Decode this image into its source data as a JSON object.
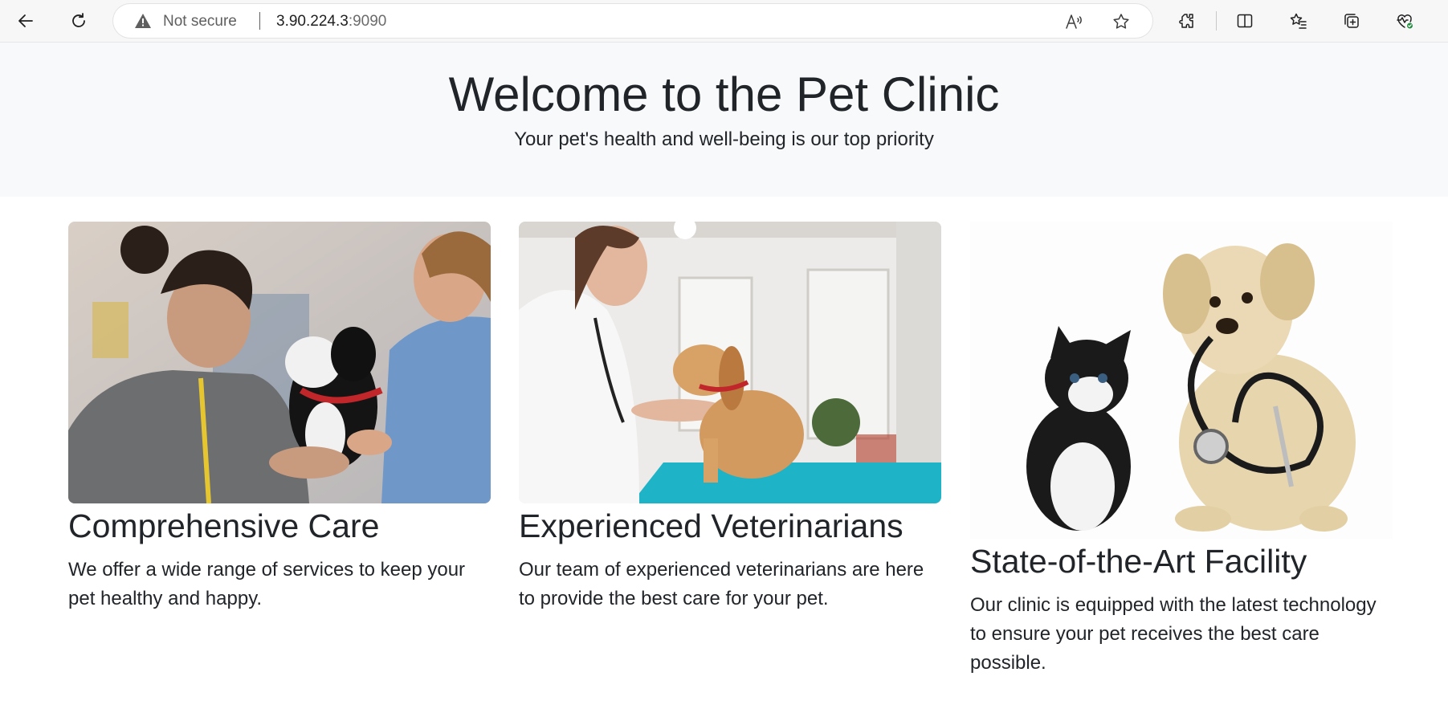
{
  "browser": {
    "security_label": "Not secure",
    "url_host": "3.90.224.3",
    "url_port": ":9090",
    "icons": [
      "back-arrow-icon",
      "refresh-icon",
      "warning-icon",
      "read-aloud-icon",
      "star-icon",
      "extensions-icon",
      "split-screen-icon",
      "favorites-icon",
      "collections-icon",
      "browser-health-icon"
    ]
  },
  "hero": {
    "title": "Welcome to the Pet Clinic",
    "subtitle": "Your pet's health and well-being is our top priority"
  },
  "cards": [
    {
      "title": "Comprehensive Care",
      "text": "We offer a wide range of services to keep your pet healthy and happy."
    },
    {
      "title": "Experienced Veterinarians",
      "text": "Our team of experienced veterinarians are here to provide the best care for your pet."
    },
    {
      "title": "State-of-the-Art Facility",
      "text": "Our clinic is equipped with the latest technology to ensure your pet receives the best care possible."
    }
  ],
  "colors": {
    "hero_bg": "#f8f9fa",
    "text": "#212529",
    "chrome_bg": "#f7f7f7",
    "health_badge": "#1e8e3e"
  }
}
